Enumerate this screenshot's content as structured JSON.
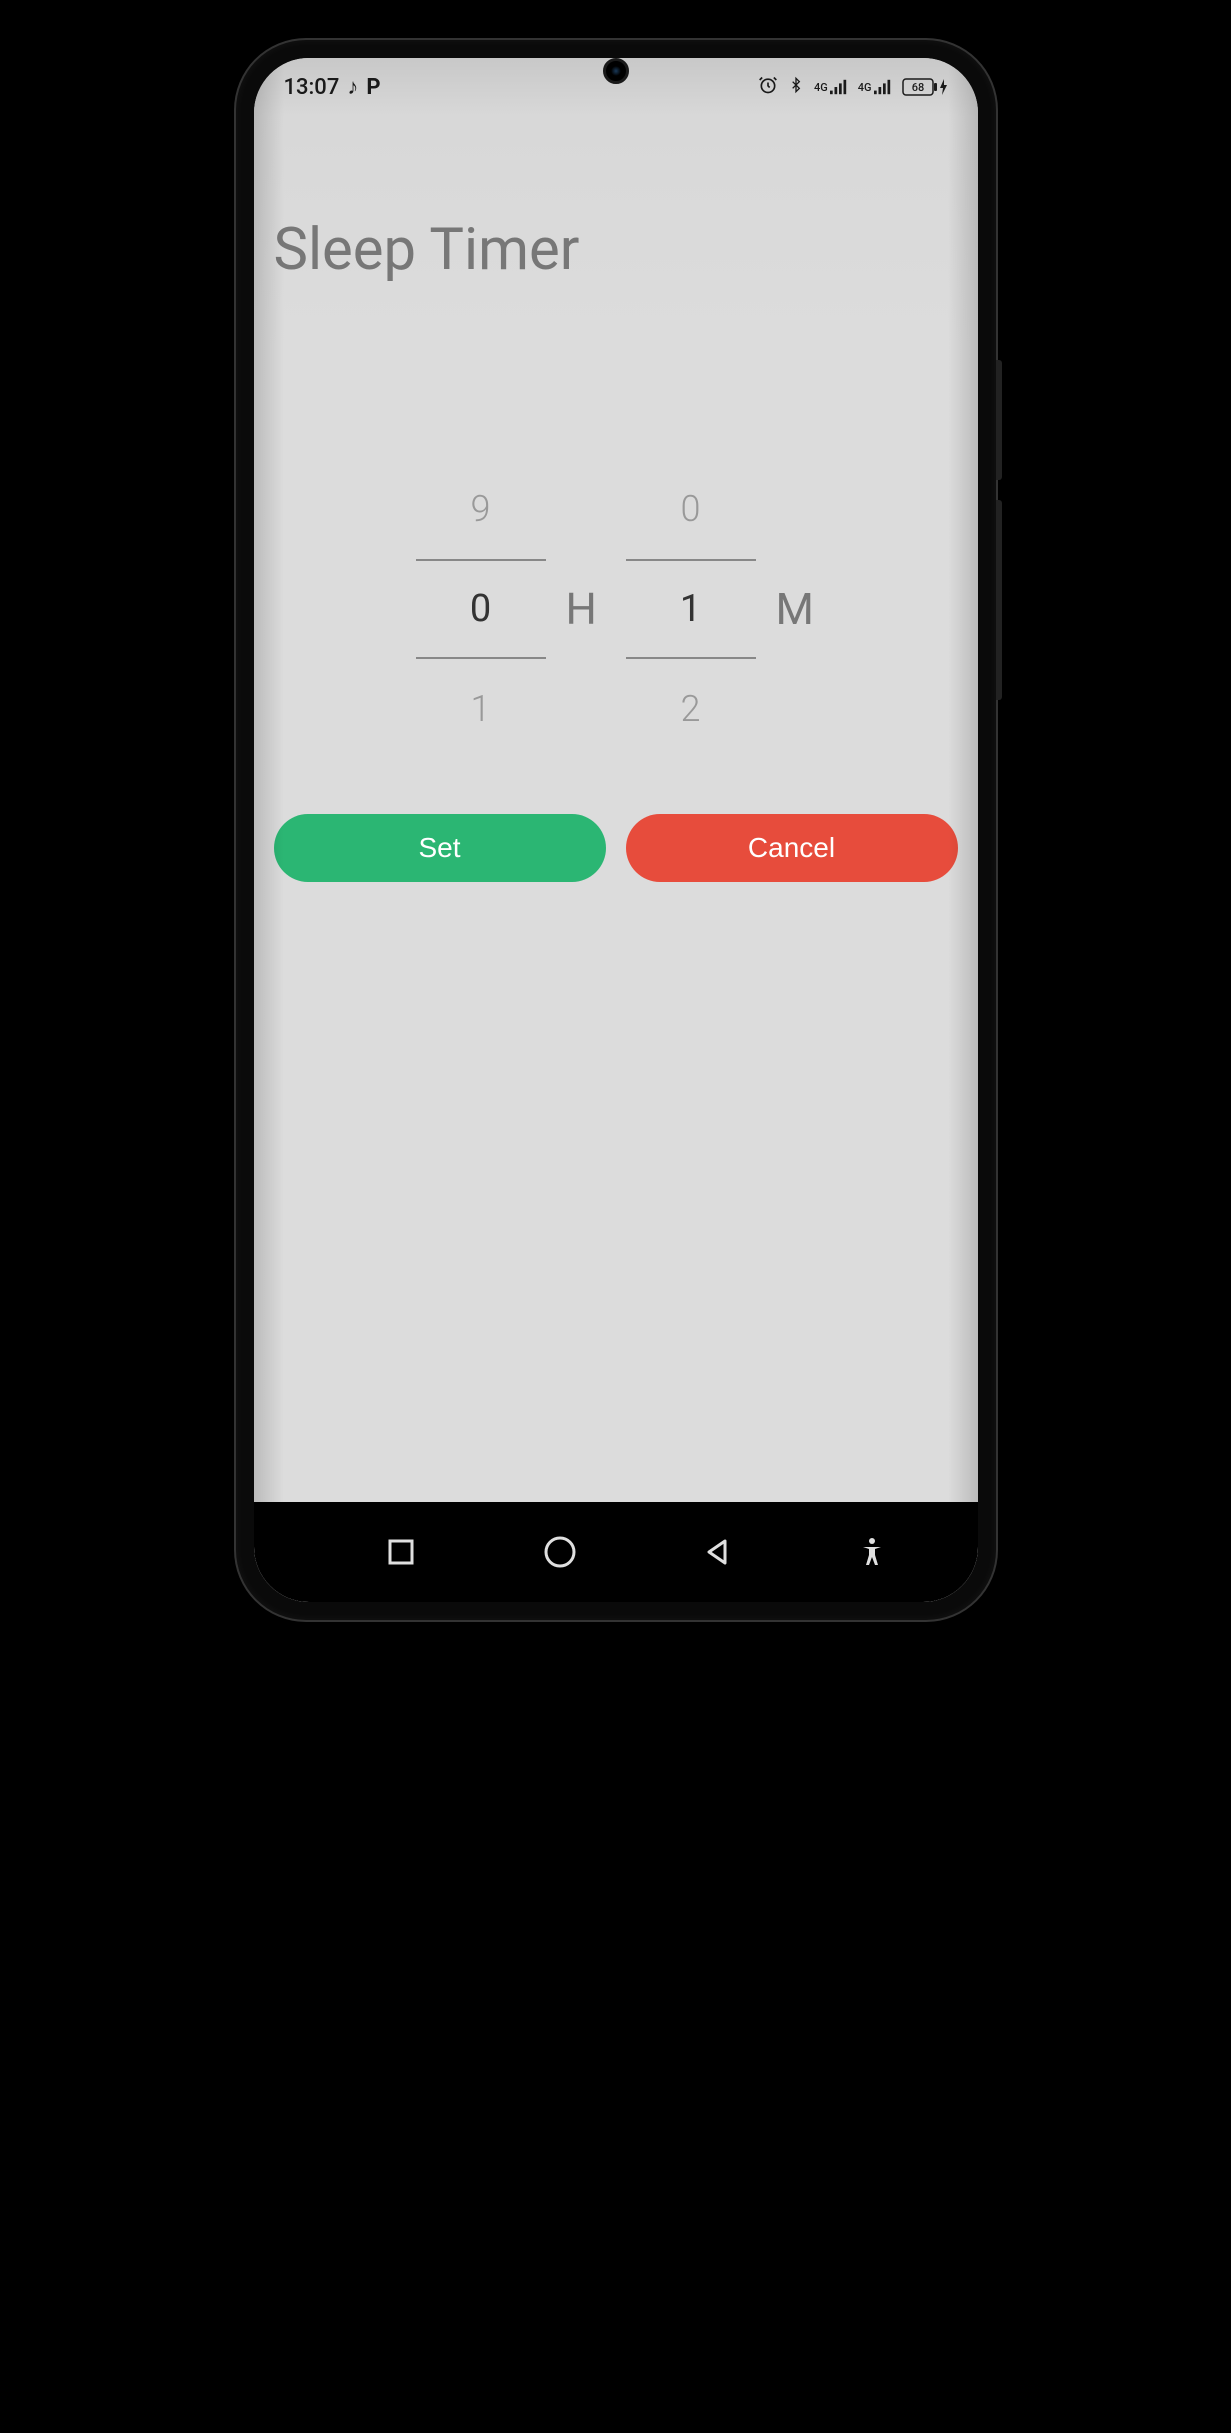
{
  "statusBar": {
    "time": "13:07",
    "musicIcon": "♪",
    "pIcon": "P",
    "alarmIcon": "alarm",
    "bluetoothIcon": "bluetooth",
    "network1": "4G",
    "network2": "4G",
    "battery": "68"
  },
  "header": {
    "title": "Sleep Timer"
  },
  "picker": {
    "hours": {
      "prev": "9",
      "current": "0",
      "next": "1",
      "unit": "H"
    },
    "minutes": {
      "prev": "0",
      "current": "1",
      "next": "2",
      "unit": "M"
    }
  },
  "buttons": {
    "set": "Set",
    "cancel": "Cancel"
  },
  "colors": {
    "setButton": "#2bb673",
    "cancelButton": "#e74c3c"
  }
}
